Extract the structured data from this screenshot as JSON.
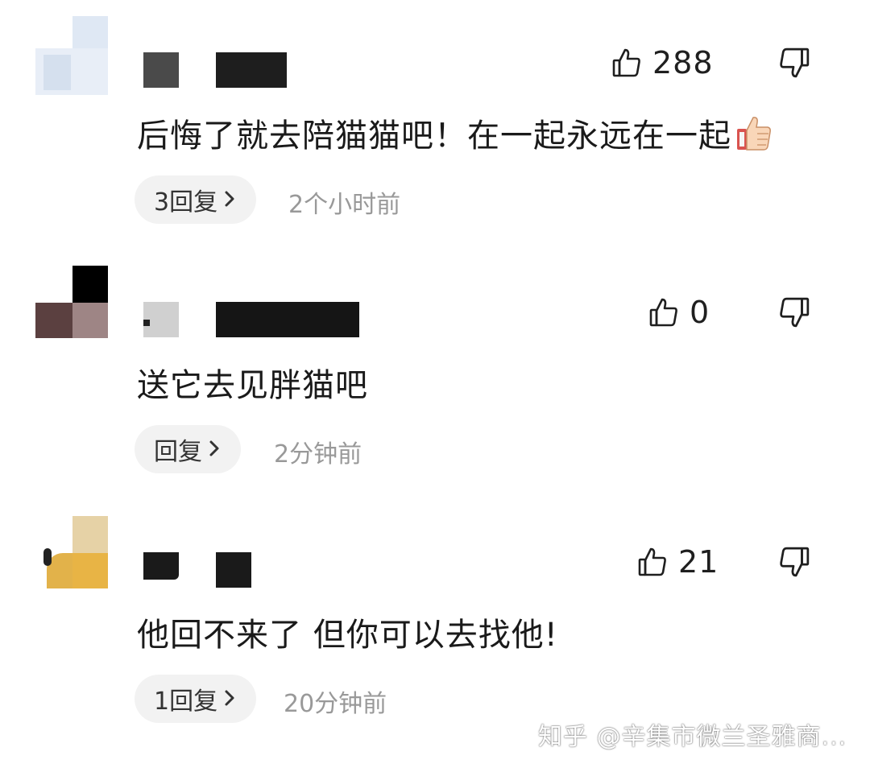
{
  "comments": [
    {
      "likes": "288",
      "text": "后悔了就去陪猫猫吧！在一起永远在一起",
      "reply_label": "3回复",
      "time": "2个小时前"
    },
    {
      "likes": "0",
      "text": "送它去见胖猫吧",
      "reply_label": "回复",
      "time": "2分钟前"
    },
    {
      "likes": "21",
      "text": "他回不来了 但你可以去找他!",
      "reply_label": "1回复",
      "time": "20分钟前"
    }
  ],
  "watermark": "知乎 @辛集市微兰圣雅商...",
  "icons": {
    "like": "thumbs-up-icon",
    "dislike": "thumbs-down-icon",
    "reply_chevron": "chevron-right-icon",
    "emoji": "thumbs-up-emoji"
  },
  "colors": {
    "pill_bg": "#f2f2f2",
    "time_text": "#999999",
    "body_text": "#1a1a1a"
  }
}
